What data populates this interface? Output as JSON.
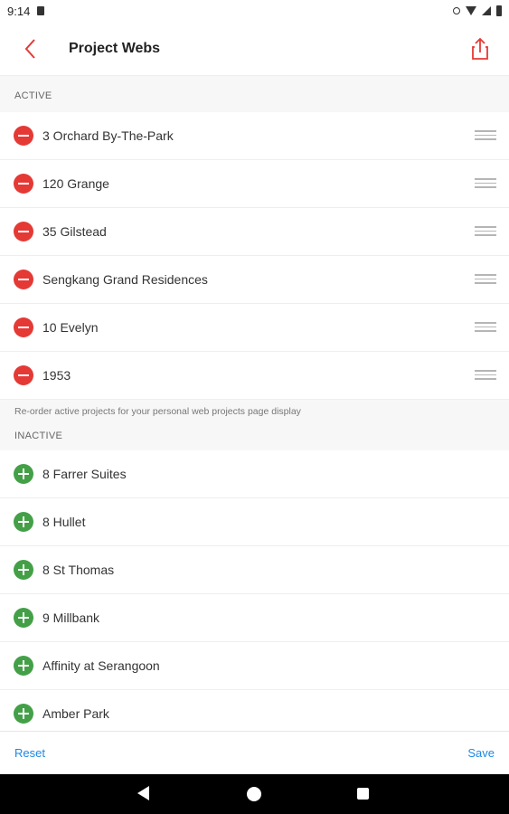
{
  "status_bar": {
    "time": "9:14"
  },
  "app_bar": {
    "title": "Project Webs"
  },
  "sections": {
    "active_header": "ACTIVE",
    "active_items": [
      "3 Orchard By-The-Park",
      "120 Grange",
      "35 Gilstead",
      "Sengkang Grand Residences",
      "10 Evelyn",
      "1953"
    ],
    "hint": "Re-order active projects for your personal web projects page display",
    "inactive_header": "INACTIVE",
    "inactive_items": [
      "8 Farrer Suites",
      "8 Hullet",
      "8 St Thomas",
      "9 Millbank",
      "Affinity at Serangoon",
      "Amber Park"
    ]
  },
  "footer": {
    "reset_label": "Reset",
    "save_label": "Save"
  },
  "colors": {
    "accent": "#e53935",
    "add": "#43a047",
    "link": "#1e88e5"
  },
  "icons": {
    "back": "chevron-left-icon",
    "share": "share-icon",
    "remove": "remove-circle-icon",
    "add": "add-circle-icon",
    "drag": "drag-handle-icon"
  }
}
